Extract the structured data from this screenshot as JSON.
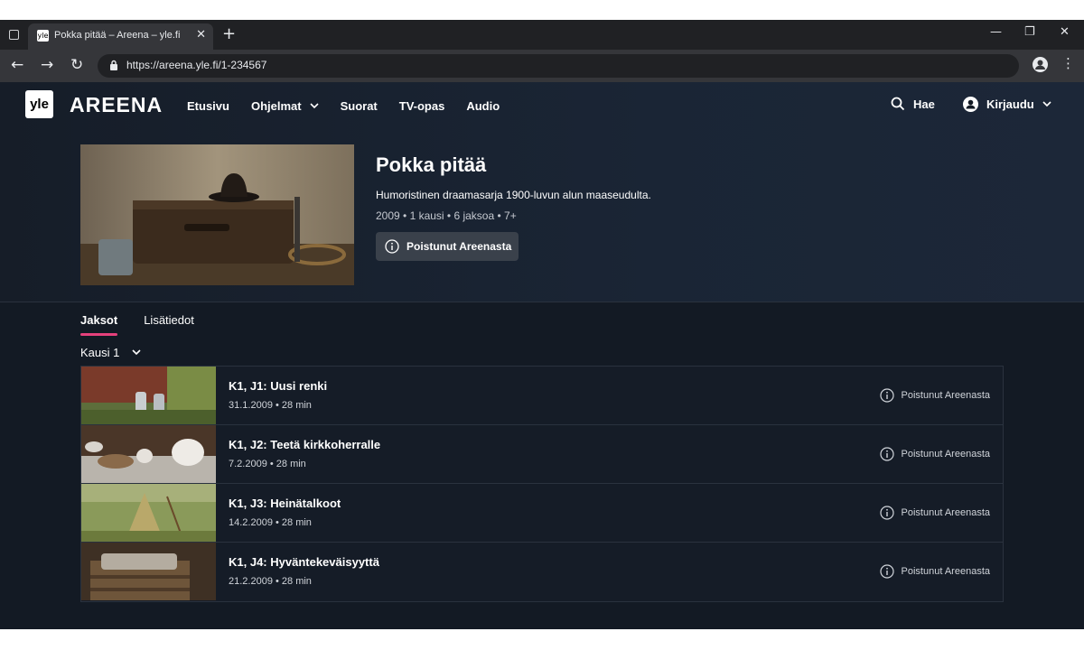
{
  "browser": {
    "tab_title": "Pokka pitää – Areena – yle.fi",
    "tab_favicon": "yle",
    "url": "https://areena.yle.fi/1-234567"
  },
  "header": {
    "logo": "yle",
    "brand": "AREENA",
    "nav": [
      "Etusivu",
      "Ohjelmat",
      "Suorat",
      "TV-opas",
      "Audio"
    ],
    "search_label": "Hae",
    "login_label": "Kirjaudu"
  },
  "show": {
    "title": "Pokka pitää",
    "description": "Humoristinen draamasarja 1900-luvun alun maaseudulta.",
    "meta": "2009  •  1 kausi  •  6 jaksoa  •  7+",
    "status": "Poistunut Areenasta"
  },
  "page_tabs": [
    "Jaksot",
    "Lisätiedot"
  ],
  "season": "Kausi 1",
  "episodes": [
    {
      "title": "K1, J1:  Uusi renki",
      "meta": "31.1.2009  •  28 min",
      "status": "Poistunut Areenasta"
    },
    {
      "title": "K1, J2:  Teetä kirkkoherralle",
      "meta": "7.2.2009  •  28 min",
      "status": "Poistunut Areenasta"
    },
    {
      "title": "K1, J3:  Heinätalkoot",
      "meta": "14.2.2009  •  28 min",
      "status": "Poistunut Areenasta"
    },
    {
      "title": "K1, J4:  Hyväntekeväisyyttä",
      "meta": "21.2.2009  •  28 min",
      "status": "Poistunut Areenasta"
    }
  ],
  "colors": {
    "page_bg": "#131a24",
    "accent": "#e5417c",
    "button_bg": "#3a414b"
  }
}
